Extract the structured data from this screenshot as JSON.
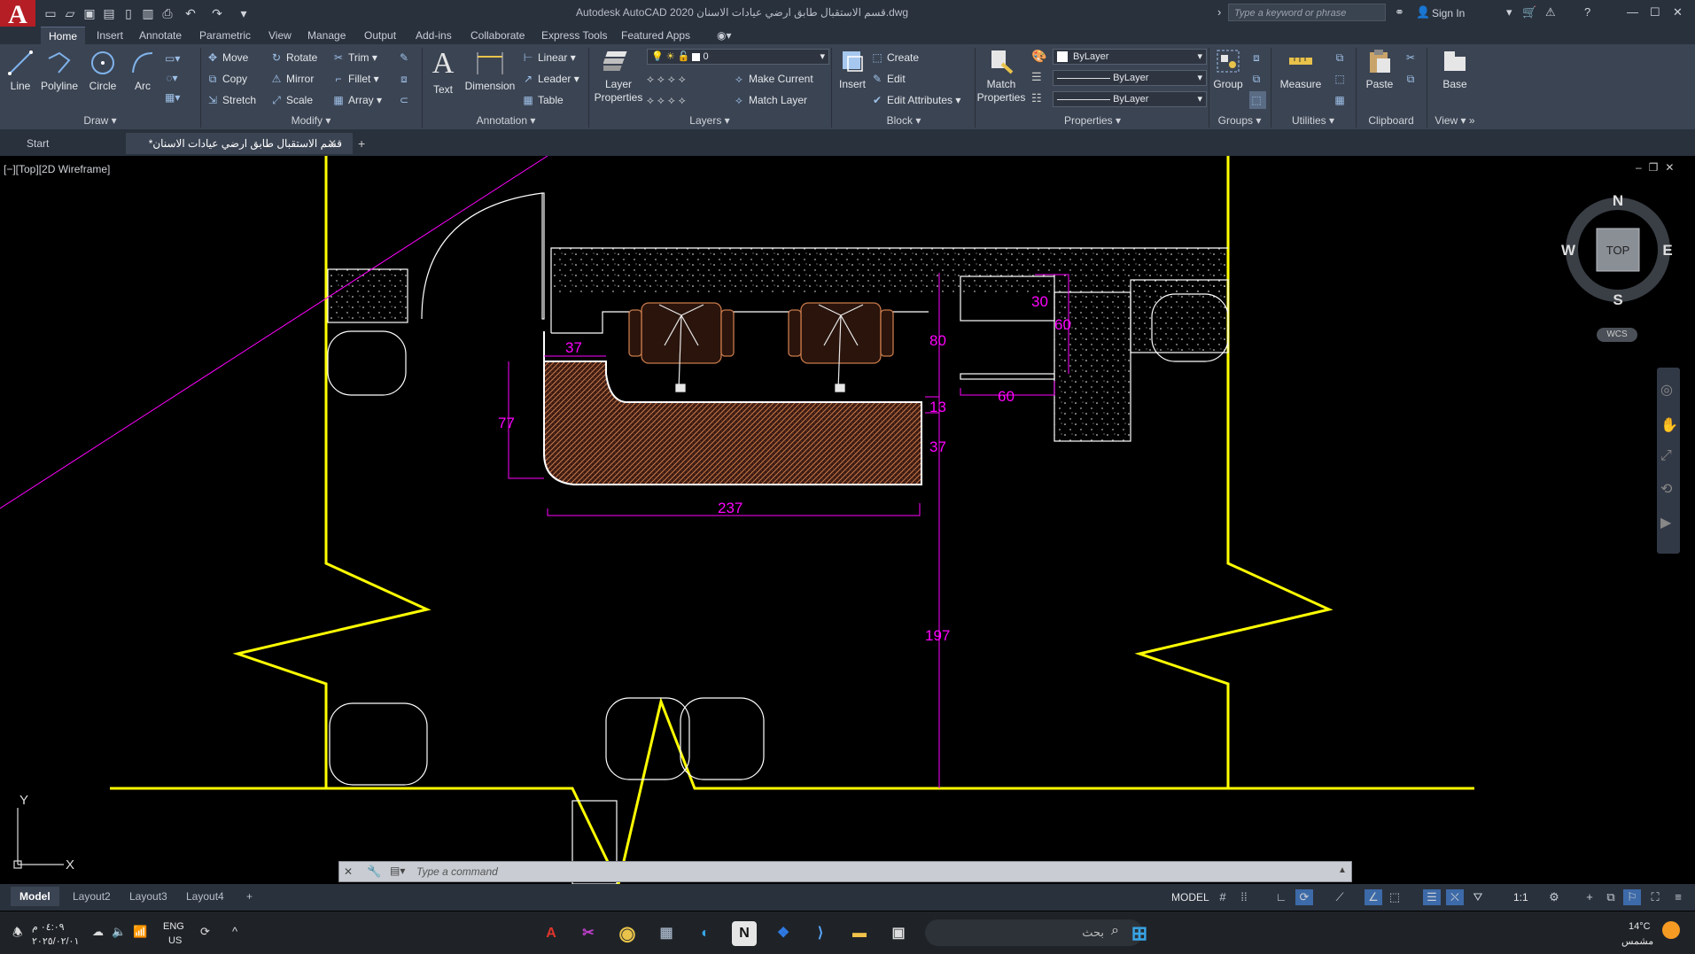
{
  "app": {
    "logo_letter": "A",
    "window_title": "Autodesk AutoCAD 2020   قسم الاستقبال طابق ارضي عيادات الاسنان.dwg",
    "search_placeholder": "Type a keyword or phrase",
    "sign_in": "Sign In"
  },
  "ribbon_tabs": [
    "Home",
    "Insert",
    "Annotate",
    "Parametric",
    "View",
    "Manage",
    "Output",
    "Add-ins",
    "Collaborate",
    "Express Tools",
    "Featured Apps"
  ],
  "ribbon": {
    "draw": {
      "title": "Draw",
      "line": "Line",
      "polyline": "Polyline",
      "circle": "Circle",
      "arc": "Arc"
    },
    "modify": {
      "title": "Modify",
      "move": "Move",
      "rotate": "Rotate",
      "trim": "Trim",
      "copy": "Copy",
      "mirror": "Mirror",
      "fillet": "Fillet",
      "stretch": "Stretch",
      "scale": "Scale",
      "array": "Array"
    },
    "annotation": {
      "title": "Annotation",
      "text": "Text",
      "dimension": "Dimension",
      "linear": "Linear",
      "leader": "Leader",
      "table": "Table"
    },
    "layers": {
      "title": "Layers",
      "layer_properties_line1": "Layer",
      "layer_properties_line2": "Properties",
      "current_layer": "0",
      "make_current": "Make Current",
      "match_layer": "Match Layer"
    },
    "block": {
      "title": "Block",
      "insert": "Insert",
      "create": "Create",
      "edit": "Edit",
      "edit_attributes": "Edit Attributes"
    },
    "properties": {
      "title": "Properties",
      "match_line1": "Match",
      "match_line2": "Properties",
      "color": "ByLayer",
      "linetype": "ByLayer",
      "lineweight": "ByLayer"
    },
    "groups": {
      "title": "Groups",
      "group": "Group"
    },
    "utilities": {
      "title": "Utilities",
      "measure": "Measure"
    },
    "clipboard": {
      "title": "Clipboard",
      "paste": "Paste"
    },
    "view": {
      "title": "View",
      "base": "Base"
    }
  },
  "doc_tabs": {
    "start": "Start",
    "active": "قسم الاستقبال طابق ارضي عيادات الاسنان*"
  },
  "viewport": {
    "label": "[−][Top][2D Wireframe]",
    "viewcube": {
      "top": "TOP",
      "n": "N",
      "s": "S",
      "e": "E",
      "w": "W",
      "wcs": "WCS"
    },
    "ucs": {
      "x": "X",
      "y": "Y"
    },
    "dimensions": [
      "37",
      "77",
      "237",
      "13",
      "37",
      "80",
      "30",
      "60",
      "60",
      "197"
    ]
  },
  "command": {
    "placeholder": "Type a command"
  },
  "layout_tabs": [
    "Model",
    "Layout2",
    "Layout3",
    "Layout4"
  ],
  "status": {
    "model": "MODEL",
    "scale": "1:1"
  },
  "taskbar": {
    "time": "٠٤:٠٩ م",
    "date": "٢٠٢٥/٠٢/٠١",
    "lang_line1": "ENG",
    "lang_line2": "US",
    "search": "بحث",
    "temp": "14°C",
    "weather": "مشمس"
  },
  "colors": {
    "wall": "#ffff00",
    "dimension": "#ff00ff",
    "furniture": "#c87a4a",
    "background": "#000000"
  }
}
